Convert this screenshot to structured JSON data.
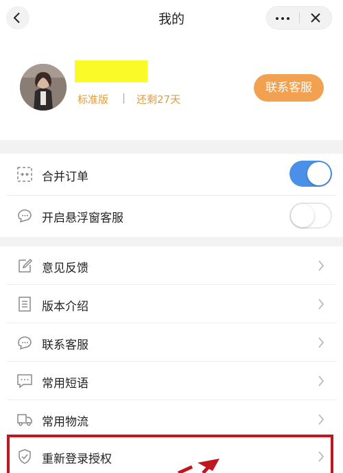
{
  "header": {
    "title": "我的"
  },
  "profile": {
    "plan": "标准版",
    "remaining": "还剩27天",
    "contact_button": "联系客服"
  },
  "toggles": [
    {
      "label": "合并订单",
      "icon": "merge-icon",
      "state": "on"
    },
    {
      "label": "开启悬浮窗客服",
      "icon": "chat-bubble-icon",
      "state": "off"
    }
  ],
  "menu": [
    {
      "label": "意见反馈",
      "icon": "edit-icon"
    },
    {
      "label": "版本介绍",
      "icon": "document-icon"
    },
    {
      "label": "联系客服",
      "icon": "chat-bubble-icon"
    },
    {
      "label": "常用短语",
      "icon": "message-icon"
    },
    {
      "label": "常用物流",
      "icon": "truck-icon"
    },
    {
      "label": "重新登录授权",
      "icon": "shield-check-icon"
    }
  ],
  "colors": {
    "accent_orange": "#f2a150",
    "plan_text": "#e49b3b",
    "toggle_on": "#4a8fe8",
    "annotation_red": "#c0161f",
    "name_highlight": "#fafa28"
  }
}
